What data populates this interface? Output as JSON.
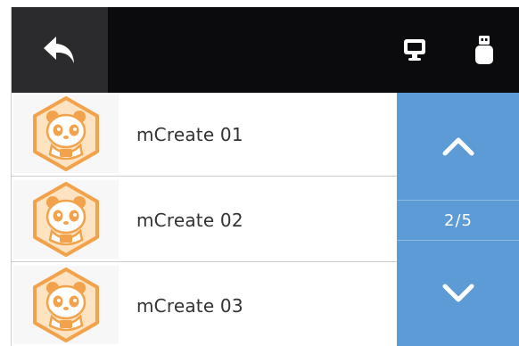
{
  "colors": {
    "topbar": "#0b0b0e",
    "back_button": "#2b2b2d",
    "pager": "#5c9bd5",
    "thumbnail_accent": "#f2a24a"
  },
  "topbar": {
    "icons": [
      "back-arrow-icon",
      "monitor-icon",
      "usb-drive-icon"
    ]
  },
  "files": [
    {
      "name": "mCreate 01",
      "thumbnail_icon": "panda-logo-icon"
    },
    {
      "name": "mCreate 02",
      "thumbnail_icon": "panda-logo-icon"
    },
    {
      "name": "mCreate 03",
      "thumbnail_icon": "panda-logo-icon"
    }
  ],
  "pager": {
    "indicator": "2/5",
    "up_icon": "chevron-up-icon",
    "down_icon": "chevron-down-icon"
  }
}
